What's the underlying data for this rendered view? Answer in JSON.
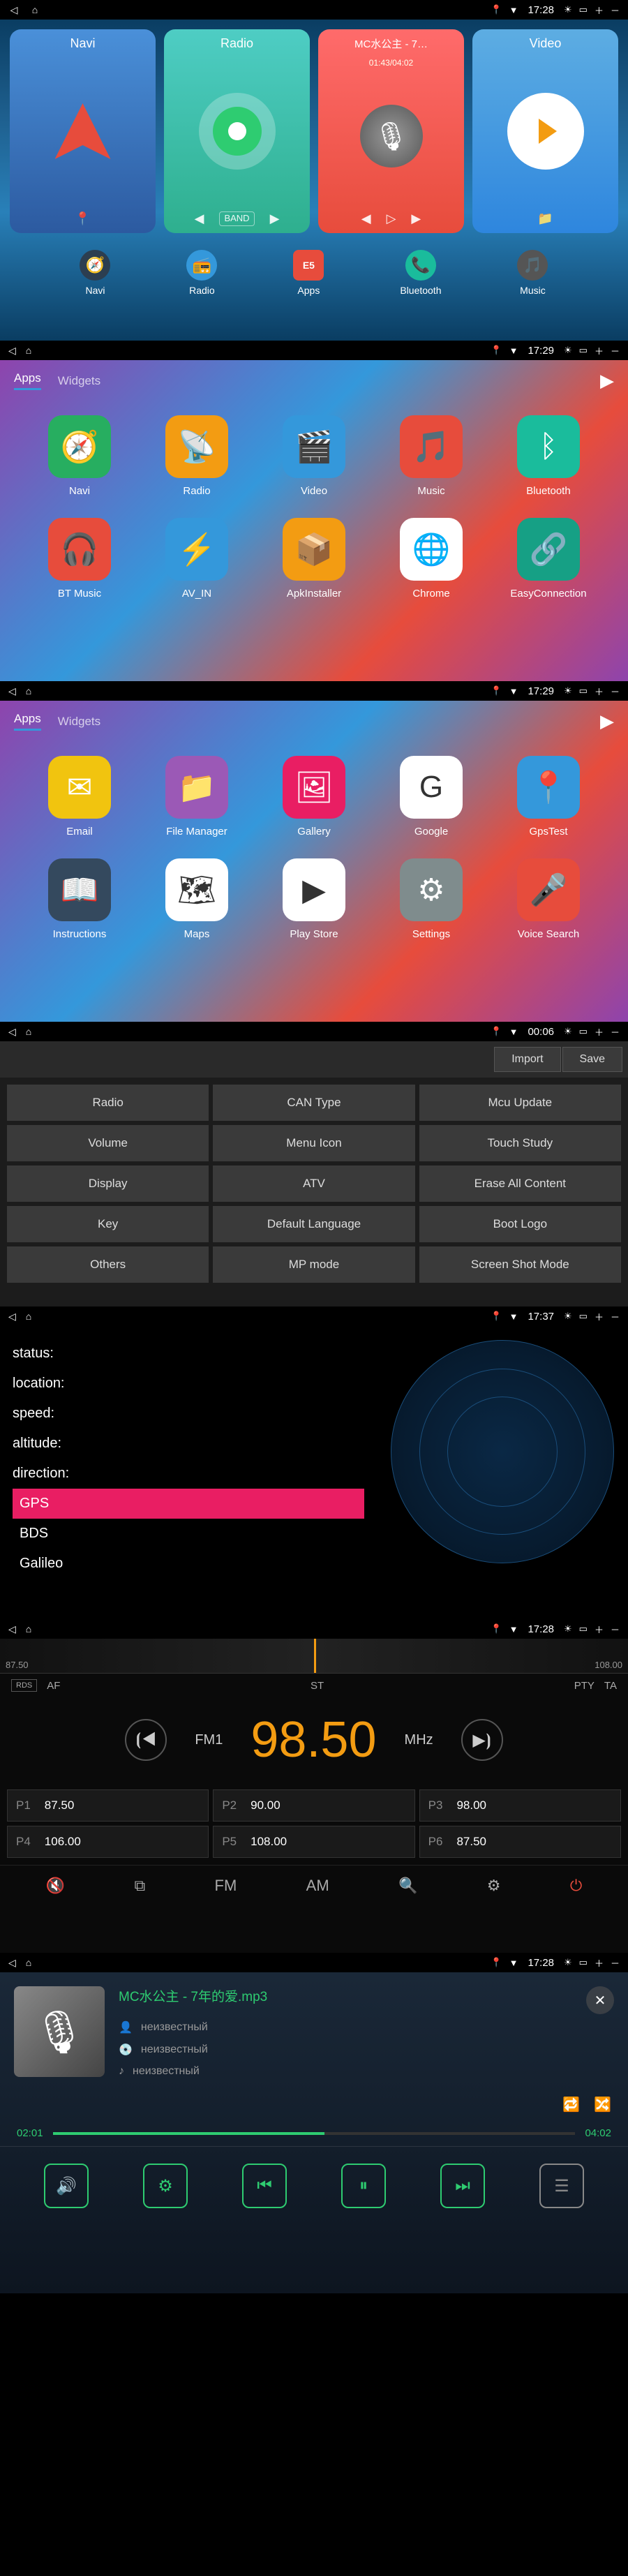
{
  "status_bars": [
    {
      "time": "17:28"
    },
    {
      "time": "17:29"
    },
    {
      "time": "17:29"
    },
    {
      "time": "00:06"
    },
    {
      "time": "17:37"
    },
    {
      "time": "17:28"
    },
    {
      "time": "17:28"
    }
  ],
  "home": {
    "cards": {
      "navi": {
        "title": "Navi"
      },
      "radio": {
        "title": "Radio",
        "band": "BAND"
      },
      "music": {
        "title": "MC水公主 - 7…",
        "time": "01:43/04:02"
      },
      "video": {
        "title": "Video"
      }
    },
    "dock": [
      {
        "label": "Navi"
      },
      {
        "label": "Radio"
      },
      {
        "label": "Apps",
        "badge": "E5"
      },
      {
        "label": "Bluetooth"
      },
      {
        "label": "Music"
      }
    ]
  },
  "drawer_tabs": {
    "apps": "Apps",
    "widgets": "Widgets"
  },
  "apps_page1": [
    {
      "label": "Navi",
      "bg": "#27ae60"
    },
    {
      "label": "Radio",
      "bg": "#f39c12"
    },
    {
      "label": "Video",
      "bg": "#3498db"
    },
    {
      "label": "Music",
      "bg": "#e74c3c"
    },
    {
      "label": "Bluetooth",
      "bg": "#1abc9c"
    },
    {
      "label": "BT Music",
      "bg": "#e74c3c"
    },
    {
      "label": "AV_IN",
      "bg": "#3498db"
    },
    {
      "label": "ApkInstaller",
      "bg": "#f39c12"
    },
    {
      "label": "Chrome",
      "bg": "#fff"
    },
    {
      "label": "EasyConnection",
      "bg": "#16a085"
    }
  ],
  "apps_page2": [
    {
      "label": "Email",
      "bg": "#f1c40f"
    },
    {
      "label": "File Manager",
      "bg": "#9b59b6"
    },
    {
      "label": "Gallery",
      "bg": "#e91e63"
    },
    {
      "label": "Google",
      "bg": "#fff"
    },
    {
      "label": "GpsTest",
      "bg": "#3498db"
    },
    {
      "label": "Instructions",
      "bg": "#34495e"
    },
    {
      "label": "Maps",
      "bg": "#fff"
    },
    {
      "label": "Play Store",
      "bg": "#fff"
    },
    {
      "label": "Settings",
      "bg": "#7f8c8d"
    },
    {
      "label": "Voice Search",
      "bg": "#e74c3c"
    }
  ],
  "settings": {
    "import": "Import",
    "save": "Save",
    "cells": [
      "Radio",
      "CAN Type",
      "Mcu Update",
      "Volume",
      "Menu Icon",
      "Touch Study",
      "Display",
      "ATV",
      "Erase All Content",
      "Key",
      "Default Language",
      "Boot Logo",
      "Others",
      "MP mode",
      "Screen Shot Mode"
    ]
  },
  "gps": {
    "rows": [
      "status:",
      "location:",
      "speed:",
      "altitude:",
      "direction:"
    ],
    "systems": [
      "GPS",
      "BDS",
      "Galileo"
    ]
  },
  "radio": {
    "dial_min": "87.50",
    "dial_max": "108.00",
    "flags": [
      "AF",
      "ST",
      "PTY",
      "TA"
    ],
    "rds": "RDS",
    "band": "FM1",
    "freq": "98.50",
    "unit": "MHz",
    "presets": [
      {
        "n": "P1",
        "v": "87.50"
      },
      {
        "n": "P2",
        "v": "90.00"
      },
      {
        "n": "P3",
        "v": "98.00"
      },
      {
        "n": "P4",
        "v": "106.00"
      },
      {
        "n": "P5",
        "v": "108.00"
      },
      {
        "n": "P6",
        "v": "87.50"
      }
    ],
    "bottom": {
      "fm": "FM",
      "am": "AM"
    }
  },
  "player": {
    "title": "MC水公主 - 7年的爱.mp3",
    "meta": [
      "неизвестный",
      "неизвестный",
      "неизвестный"
    ],
    "pos": "02:01",
    "dur": "04:02"
  }
}
